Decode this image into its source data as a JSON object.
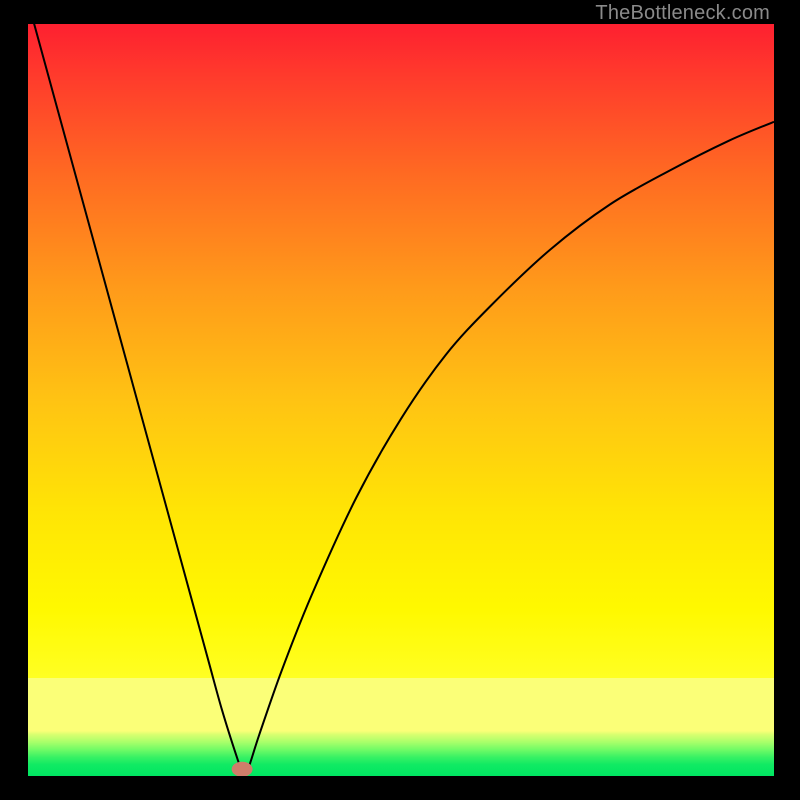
{
  "watermark": "TheBottleneck.com",
  "chart_data": {
    "type": "line",
    "title": "",
    "xlabel": "",
    "ylabel": "",
    "xlim": [
      0,
      100
    ],
    "ylim": [
      0,
      100
    ],
    "grid": false,
    "series": [
      {
        "name": "curve",
        "x": [
          0,
          4,
          8,
          12,
          16,
          20,
          24,
          26,
          28,
          28.7,
          29.4,
          31,
          34,
          38,
          44,
          50,
          56,
          62,
          70,
          78,
          86,
          94,
          100
        ],
        "y": [
          103,
          88.5,
          74,
          59.5,
          45,
          30.5,
          16,
          8.8,
          2.5,
          0.7,
          0.7,
          5.5,
          14,
          24,
          37,
          47.5,
          56,
          62.5,
          70,
          76,
          80.5,
          84.5,
          87
        ]
      }
    ],
    "marker": {
      "x": 28.7,
      "y": 0.9,
      "rx": 1.4,
      "ry": 1.0,
      "color": "#cf7d6a"
    },
    "colors": {
      "curve_stroke": "#000000",
      "marker_fill": "#cf7d6a",
      "frame_bg_top": "#fe2030",
      "frame_bg_mid": "#ffe700",
      "frame_bg_bottom_band": "#fbff78",
      "frame_bg_green": "#00e662"
    }
  }
}
